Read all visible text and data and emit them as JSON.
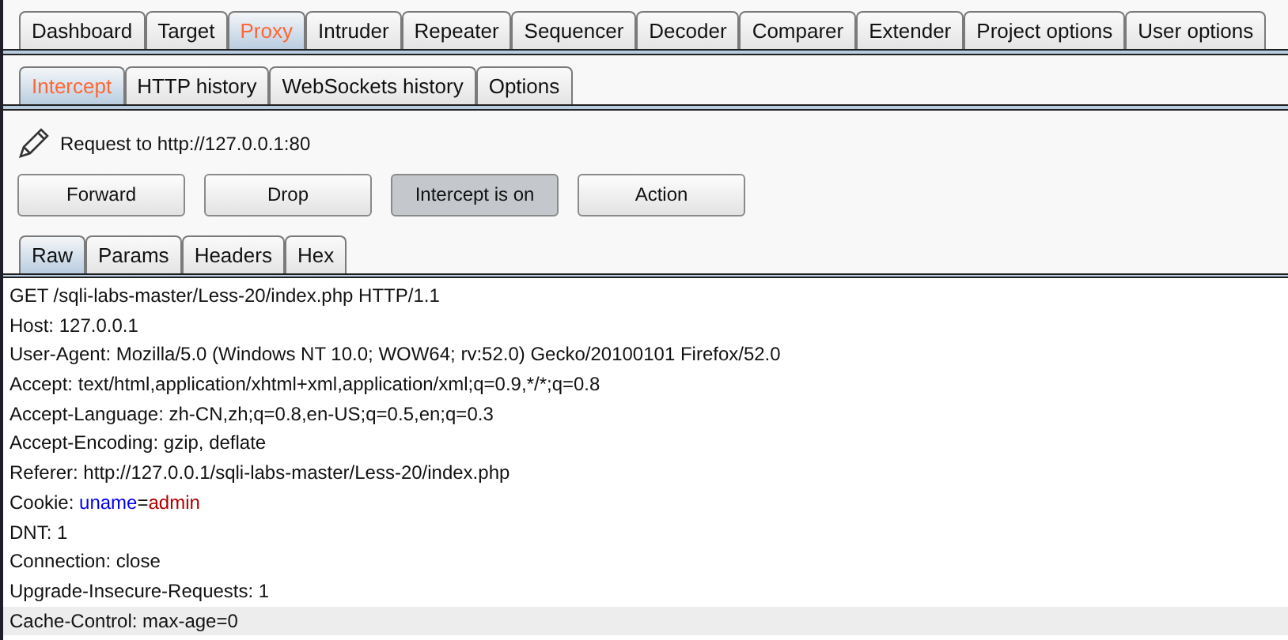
{
  "main_tabs": [
    {
      "label": "Dashboard",
      "selected": false
    },
    {
      "label": "Target",
      "selected": false
    },
    {
      "label": "Proxy",
      "selected": true
    },
    {
      "label": "Intruder",
      "selected": false
    },
    {
      "label": "Repeater",
      "selected": false
    },
    {
      "label": "Sequencer",
      "selected": false
    },
    {
      "label": "Decoder",
      "selected": false
    },
    {
      "label": "Comparer",
      "selected": false
    },
    {
      "label": "Extender",
      "selected": false
    },
    {
      "label": "Project options",
      "selected": false
    },
    {
      "label": "User options",
      "selected": false
    }
  ],
  "proxy_tabs": [
    {
      "label": "Intercept",
      "selected": true
    },
    {
      "label": "HTTP history",
      "selected": false
    },
    {
      "label": "WebSockets history",
      "selected": false
    },
    {
      "label": "Options",
      "selected": false
    }
  ],
  "request_label": "Request to http://127.0.0.1:80",
  "buttons": [
    {
      "label": "Forward",
      "pressed": false
    },
    {
      "label": "Drop",
      "pressed": false
    },
    {
      "label": "Intercept is on",
      "pressed": true
    },
    {
      "label": "Action",
      "pressed": false
    }
  ],
  "view_tabs": [
    {
      "label": "Raw",
      "selected": true
    },
    {
      "label": "Params",
      "selected": false
    },
    {
      "label": "Headers",
      "selected": false
    },
    {
      "label": "Hex",
      "selected": false
    }
  ],
  "request_lines": [
    {
      "selected": false,
      "segments": [
        {
          "kind": "plain",
          "text": "GET /sqli-labs-master/Less-20/index.php HTTP/1.1"
        }
      ]
    },
    {
      "selected": false,
      "segments": [
        {
          "kind": "plain",
          "text": "Host: 127.0.0.1"
        }
      ]
    },
    {
      "selected": false,
      "segments": [
        {
          "kind": "plain",
          "text": "User-Agent: Mozilla/5.0 (Windows NT 10.0; WOW64; rv:52.0) Gecko/20100101 Firefox/52.0"
        }
      ]
    },
    {
      "selected": false,
      "segments": [
        {
          "kind": "plain",
          "text": "Accept: text/html,application/xhtml+xml,application/xml;q=0.9,*/*;q=0.8"
        }
      ]
    },
    {
      "selected": false,
      "segments": [
        {
          "kind": "plain",
          "text": "Accept-Language: zh-CN,zh;q=0.8,en-US;q=0.5,en;q=0.3"
        }
      ]
    },
    {
      "selected": false,
      "segments": [
        {
          "kind": "plain",
          "text": "Accept-Encoding: gzip, deflate"
        }
      ]
    },
    {
      "selected": false,
      "segments": [
        {
          "kind": "plain",
          "text": "Referer: http://127.0.0.1/sqli-labs-master/Less-20/index.php"
        }
      ]
    },
    {
      "selected": false,
      "segments": [
        {
          "kind": "plain",
          "text": "Cookie: "
        },
        {
          "kind": "param_name",
          "text": "uname"
        },
        {
          "kind": "plain",
          "text": "="
        },
        {
          "kind": "param_value",
          "text": "admin"
        }
      ]
    },
    {
      "selected": false,
      "segments": [
        {
          "kind": "plain",
          "text": "DNT: 1"
        }
      ]
    },
    {
      "selected": false,
      "segments": [
        {
          "kind": "plain",
          "text": "Connection: close"
        }
      ]
    },
    {
      "selected": false,
      "segments": [
        {
          "kind": "plain",
          "text": "Upgrade-Insecure-Requests: 1"
        }
      ]
    },
    {
      "selected": true,
      "segments": [
        {
          "kind": "plain",
          "text": "Cache-Control: max-age=0"
        }
      ]
    }
  ]
}
